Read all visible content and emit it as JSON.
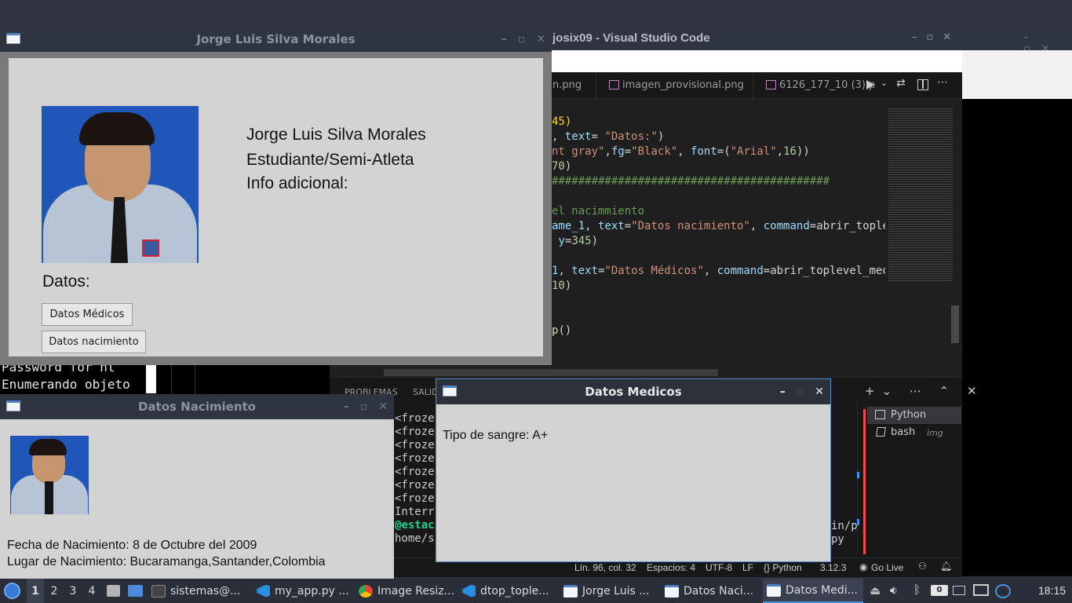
{
  "vscode": {
    "title": "josix09 - Visual Studio Code",
    "tabs": [
      "n.png",
      "imagen_provisional.png",
      "6126_177_10 (3).p"
    ],
    "code_lines": [
      {
        "parts": [
          [
            "pun",
            "45)"
          ]
        ]
      },
      {
        "parts": [
          [
            "txt",
            ", "
          ],
          [
            "var",
            "text"
          ],
          [
            "txt",
            "= "
          ],
          [
            "str",
            "\"Datos:\""
          ],
          [
            "txt",
            ")"
          ]
        ]
      },
      {
        "parts": [
          [
            "str",
            "nt gray\""
          ],
          [
            "txt",
            ","
          ],
          [
            "var",
            "fg"
          ],
          [
            "txt",
            "="
          ],
          [
            "str",
            "\"Black\""
          ],
          [
            "txt",
            ", "
          ],
          [
            "var",
            "font"
          ],
          [
            "txt",
            "=("
          ],
          [
            "str",
            "\"Arial\""
          ],
          [
            "txt",
            ","
          ],
          [
            "num",
            "16"
          ],
          [
            "txt",
            "))"
          ]
        ]
      },
      {
        "parts": [
          [
            "num",
            "70"
          ],
          [
            "txt",
            ")"
          ]
        ]
      },
      {
        "parts": [
          [
            "cmt",
            "##########################################"
          ]
        ]
      },
      {
        "parts": [
          [
            "txt",
            ""
          ]
        ]
      },
      {
        "parts": [
          [
            "cmt",
            "el nacimmiento"
          ]
        ]
      },
      {
        "parts": [
          [
            "var",
            "ame_1"
          ],
          [
            "txt",
            ", "
          ],
          [
            "var",
            "text"
          ],
          [
            "txt",
            "="
          ],
          [
            "str",
            "\"Datos nacimiento\""
          ],
          [
            "txt",
            ", "
          ],
          [
            "var",
            "command"
          ],
          [
            "txt",
            "=abrir_tople"
          ]
        ]
      },
      {
        "parts": [
          [
            "txt",
            " "
          ],
          [
            "var",
            "y"
          ],
          [
            "txt",
            "="
          ],
          [
            "num",
            "345"
          ],
          [
            "txt",
            ")"
          ]
        ]
      },
      {
        "parts": [
          [
            "txt",
            ""
          ]
        ]
      },
      {
        "parts": [
          [
            "var",
            "1"
          ],
          [
            "txt",
            ", "
          ],
          [
            "var",
            "text"
          ],
          [
            "txt",
            "="
          ],
          [
            "str",
            "\"Datos Médicos\""
          ],
          [
            "txt",
            ", "
          ],
          [
            "var",
            "command"
          ],
          [
            "txt",
            "=abrir_toplevel_med"
          ]
        ]
      },
      {
        "parts": [
          [
            "num",
            "10"
          ],
          [
            "txt",
            ")"
          ]
        ]
      },
      {
        "parts": [
          [
            "txt",
            ""
          ]
        ]
      },
      {
        "parts": [
          [
            "txt",
            ""
          ]
        ]
      },
      {
        "parts": [
          [
            "fn",
            "p"
          ],
          [
            "txt",
            "()"
          ]
        ]
      }
    ],
    "panel_tabs": [
      "PROBLEMAS",
      "SALID"
    ],
    "terminal_lines": [
      "<frozen",
      "<frozen",
      "<frozen",
      "<frozen",
      "<frozen",
      "<frozen",
      "<frozen",
      "Interru",
      "@estaci",
      "home/si"
    ],
    "terminal_right_lines": [
      "in/p",
      "py"
    ],
    "terminals": [
      {
        "name": "Python",
        "hint": ""
      },
      {
        "name": "bash",
        "hint": "img"
      }
    ],
    "status": {
      "position": "Lín. 96, col. 32",
      "spaces": "Espacios: 4",
      "encoding": "UTF-8",
      "eol": "LF",
      "language": "{} Python",
      "version": "3.12.3",
      "golive": "Go Live"
    }
  },
  "bg_terminal": {
    "lines": [
      "Password for  ht",
      "Enumerando objeto"
    ]
  },
  "win_main": {
    "title": "Jorge Luis Silva Morales",
    "name": "Jorge Luis Silva Morales",
    "role": "Estudiante/Semi-Atleta",
    "info": "Info adicional:",
    "datos_label": "Datos:",
    "btn_medicos": "Datos Médicos",
    "btn_nacimiento": "Datos nacimiento"
  },
  "win_nacimiento": {
    "title": "Datos Nacimiento",
    "fecha": "Fecha de Nacimiento: 8 de Octubre del 2009",
    "lugar": "Lugar de Nacimiento: Bucaramanga,Santander,Colombia"
  },
  "win_medicos": {
    "title": "Datos Medicos",
    "sangre": "Tipo de sangre: A+"
  },
  "taskbar": {
    "workspaces": [
      "1",
      "2",
      "3",
      "4"
    ],
    "tasks": [
      {
        "label": "sistemas@...",
        "icon": "terminal-icon"
      },
      {
        "label": "my_app.py ...",
        "icon": "vscode-icon"
      },
      {
        "label": "Image Resiz...",
        "icon": "chrome-icon"
      },
      {
        "label": "dtop_tople...",
        "icon": "vscode-icon"
      },
      {
        "label": "Jorge Luis ...",
        "icon": "window-icon"
      },
      {
        "label": "Datos Naci...",
        "icon": "window-icon"
      },
      {
        "label": "Datos Medi...",
        "icon": "window-icon"
      }
    ],
    "battery_badge": "0",
    "clock": "18:15"
  }
}
